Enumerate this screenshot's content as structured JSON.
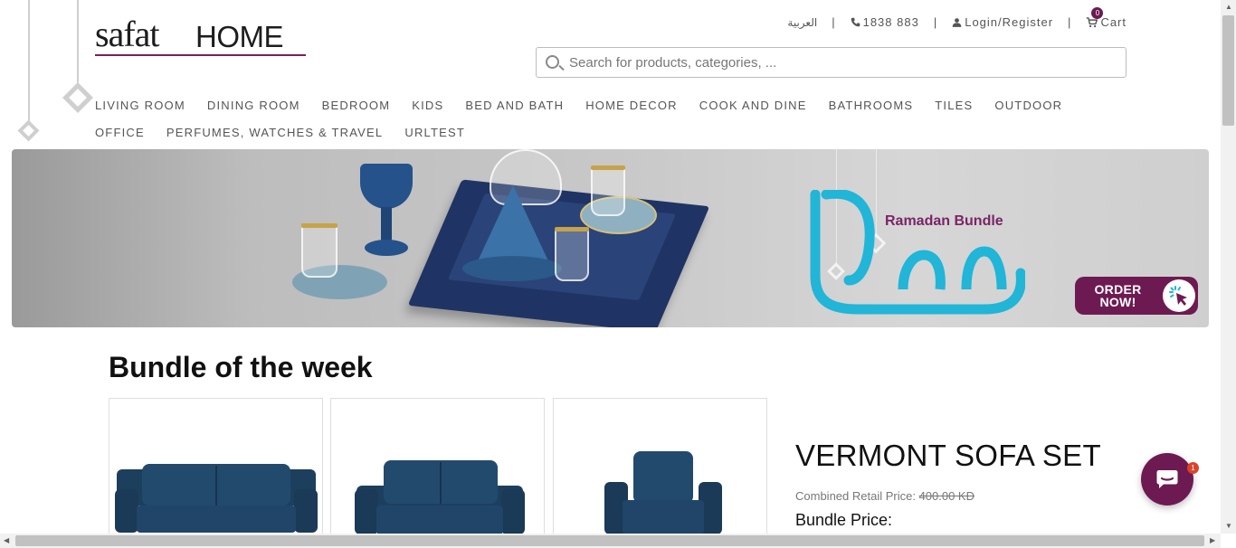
{
  "brand": {
    "name_part1": "safat",
    "name_part2": "HOME"
  },
  "top_links": {
    "language": "العربية",
    "phone": "1838 883",
    "login": "Login/Register",
    "cart_label": "Cart",
    "cart_count": "0"
  },
  "search": {
    "placeholder": "Search for products, categories, ..."
  },
  "nav": {
    "items": [
      "LIVING ROOM",
      "DINING ROOM",
      "BEDROOM",
      "KIDS",
      "BED AND BATH",
      "HOME DECOR",
      "COOK AND DINE",
      "BATHROOMS",
      "TILES",
      "OUTDOOR",
      "OFFICE",
      "PERFUMES, WATCHES & TRAVEL",
      "URLTEST"
    ]
  },
  "banner": {
    "headline": "Ramadan Bundle",
    "cta": "ORDER\nNOW!"
  },
  "bundle": {
    "title_bold": "Bundle",
    "title_rest": " of the week",
    "product_name": "VERMONT SOFA SET",
    "retail_label": "Combined Retail Price: ",
    "retail_price": "400.00 KD",
    "bundle_price_label": "Bundle Price:"
  },
  "chat": {
    "unread": "1"
  },
  "colors": {
    "brand": "#6e1a52",
    "sofa": "#1d3f5e",
    "ramadan_logo": "#21b5d8"
  },
  "icons": {
    "phone": "phone-icon",
    "user": "user-icon",
    "cart": "cart-icon",
    "search": "search-icon",
    "chat": "chat-icon"
  }
}
